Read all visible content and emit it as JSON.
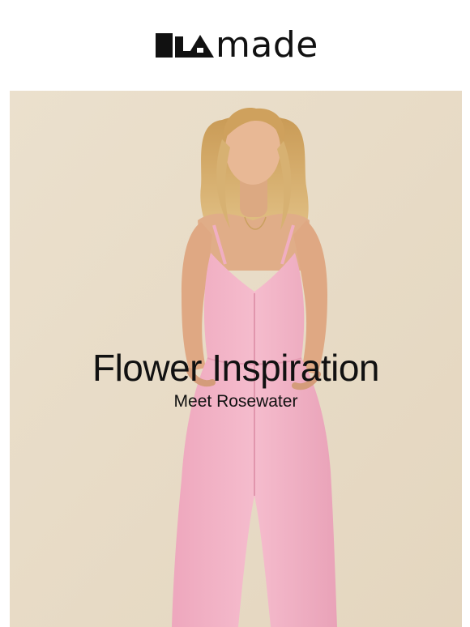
{
  "header": {
    "logo_text": "LAmade",
    "logo_word": "made"
  },
  "hero": {
    "title": "Flower Inspiration",
    "subtitle": "Meet Rosewater",
    "image_description_colors": {
      "background": "#e9ddc9",
      "garment": "#f2b6c8",
      "hair": "#d9b77a",
      "skin": "#e2b08a"
    }
  }
}
